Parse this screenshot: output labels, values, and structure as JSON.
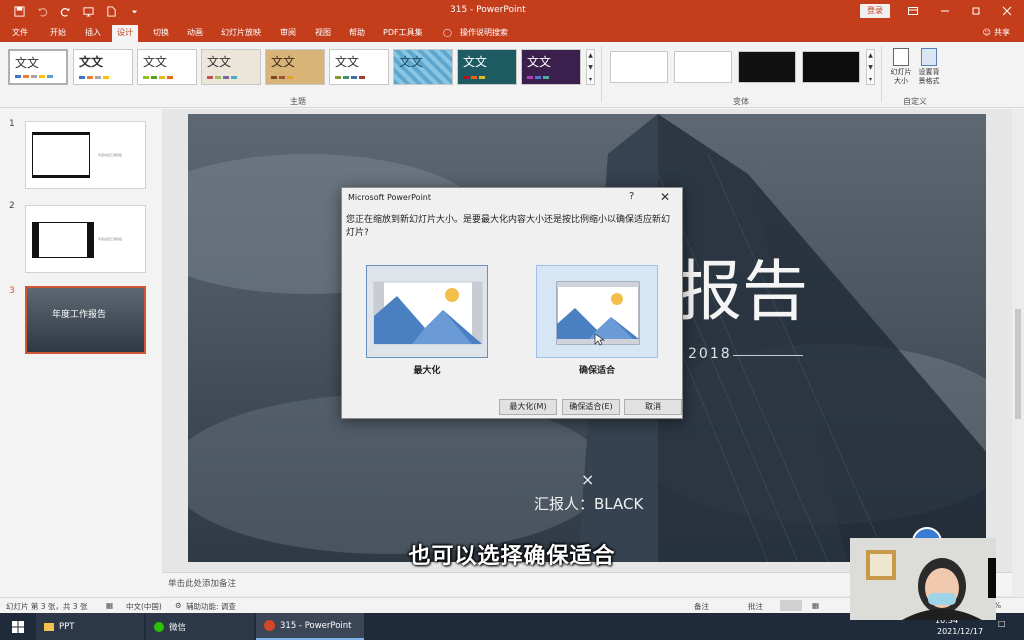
{
  "app": {
    "title": "315 - PowerPoint",
    "login": "登录",
    "share": "共享"
  },
  "menu": {
    "tabs": [
      "文件",
      "开始",
      "插入",
      "设计",
      "切换",
      "动画",
      "幻灯片放映",
      "审阅",
      "视图",
      "帮助",
      "PDF工具集"
    ],
    "active": "设计",
    "search": "操作说明搜索"
  },
  "ribbon": {
    "theme_sample": "文文",
    "themes_label": "主题",
    "variants_label": "变体",
    "custom_label": "自定义",
    "slide_size": "幻灯片\n大小",
    "format_bg": "设置背\n景格式"
  },
  "slides": {
    "numbers": [
      "1",
      "2",
      "3"
    ],
    "thumb1_text": "年度总结汇报模板",
    "thumb3_title": "年度工作报告"
  },
  "slide": {
    "title_fragment": "报告",
    "year": "2018",
    "cross": "×",
    "reporter": "汇报人：BLACK"
  },
  "dialog": {
    "title": "Microsoft PowerPoint",
    "help": "?",
    "close": "✕",
    "message": "您正在缩放到新幻灯片大小。是要最大化内容大小还是按比例缩小以确保适应新幻灯片?",
    "option_maximize": "最大化",
    "option_ensure_fit": "确保适合",
    "btn_maximize": "最大化(M)",
    "btn_ensure_fit": "确保适合(E)",
    "btn_cancel": "取消"
  },
  "notes": {
    "placeholder": "单击此处添加备注"
  },
  "status": {
    "slide_info": "幻灯片 第 3 张，共 3 张",
    "language": "中文(中国)",
    "accessibility": "辅助功能: 调查",
    "notes": "备注",
    "comments": "批注",
    "zoom": "%"
  },
  "taskbar": {
    "tasks": [
      "PPT",
      "微信",
      "315 - PowerPoint"
    ],
    "time": "10:34",
    "date": "2021/12/17"
  },
  "subtitle": "也可以选择确保适合",
  "colors": {
    "accent": "#c43e1c",
    "dialog_blue": "#4a7fc1",
    "sun": "#f2c04a"
  }
}
